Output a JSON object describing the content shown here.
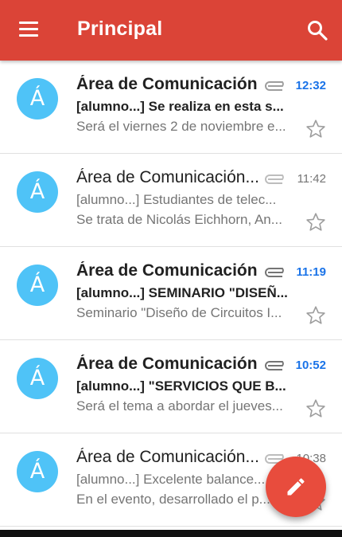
{
  "appbar": {
    "title": "Principal",
    "menu_icon": "menu-icon",
    "search_icon": "search-icon",
    "color": "#db4437"
  },
  "emails": [
    {
      "avatar": "Á",
      "sender": "Área de Comunicación",
      "subject": "[alumno...] Se realiza en esta s...",
      "snippet": "Será el viernes 2 de noviembre e...",
      "time": "12:32",
      "unread": true
    },
    {
      "avatar": "Á",
      "sender": "Área de Comunicación...",
      "subject": "[alumno...] Estudiantes de telec...",
      "snippet": "Se trata de Nicolás Eichhorn, An...",
      "time": "11:42",
      "unread": false
    },
    {
      "avatar": "Á",
      "sender": "Área de Comunicación",
      "subject": "[alumno...] SEMINARIO \"DISEÑ...",
      "snippet": "Seminario \"Diseño de Circuitos I...",
      "time": "11:19",
      "unread": true
    },
    {
      "avatar": "Á",
      "sender": "Área de Comunicación",
      "subject": "[alumno...] \"SERVICIOS QUE B...",
      "snippet": "Será el tema a abordar el jueves...",
      "time": "10:52",
      "unread": true
    },
    {
      "avatar": "Á",
      "sender": "Área de Comunicación...",
      "subject": "[alumno...] Excelente balance...",
      "snippet": "En el evento, desarrollado el p...",
      "time": "10:38",
      "unread": false
    }
  ],
  "fab": {
    "icon": "pencil-icon",
    "color": "#e84c3d"
  },
  "colors": {
    "avatar": "#4fc3f7",
    "unread_time": "#1a73e8"
  }
}
